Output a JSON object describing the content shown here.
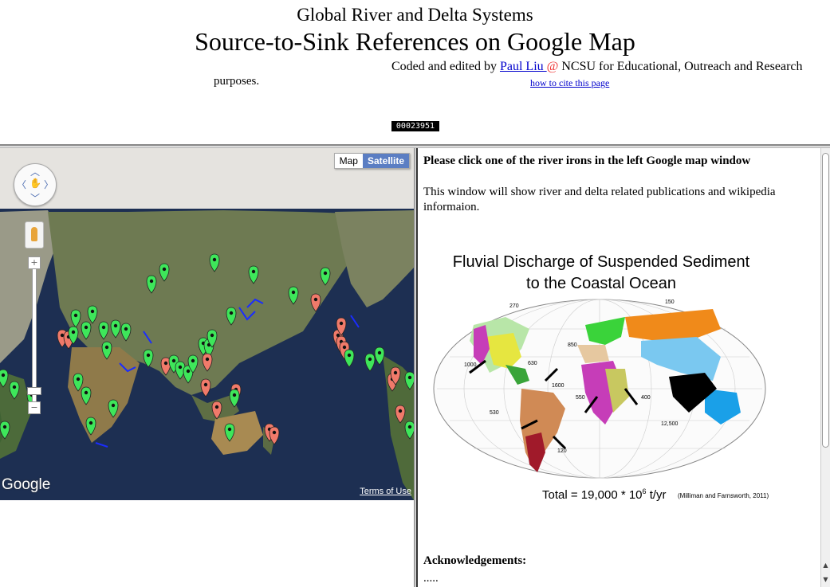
{
  "header": {
    "subtitle": "Global River and Delta Systems",
    "title": "Source-to-Sink References on Google Map",
    "credit_prefix": "Coded and edited by ",
    "author_link": "Paul Liu ",
    "at_sign": "@",
    "credit_suffix": " NCSU for Educational, Outreach and Research",
    "credit_line2": "purposes.",
    "cite_link": "how to cite this page",
    "counter": "00023951"
  },
  "map": {
    "toggle_map": "Map",
    "toggle_satellite": "Satellite",
    "active_type": "Satellite",
    "zoom_in": "+",
    "zoom_out": "−",
    "logo": "Google",
    "terms": "Terms of Use",
    "marker_colors": {
      "green": "#3ee65a",
      "red": "#f07a6a"
    }
  },
  "info": {
    "prompt": "Please click one of the river irons in the left Google map window",
    "description": "This window will show river and delta related publications and wikipedia informaion.",
    "figure": {
      "title_line1": "Fluvial Discharge of Suspended Sediment",
      "title_line2": "to the Coastal Ocean",
      "total_text": "Total = 19,000 * 10",
      "total_exp": "6",
      "total_unit": " t/yr",
      "citation": "(Milliman and Farnsworth, 2011)",
      "flux_labels": [
        "270",
        "150",
        "850",
        "1000",
        "630",
        "1600",
        "550",
        "400",
        "530",
        "12,500",
        "120"
      ]
    },
    "ack_heading": "Acknowledgements:",
    "ack_body": "....."
  }
}
